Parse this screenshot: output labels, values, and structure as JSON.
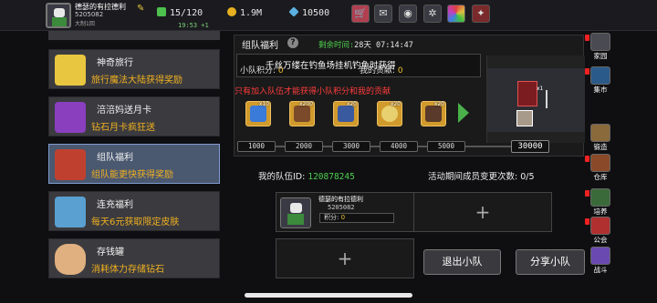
{
  "player": {
    "name": "德瑟的有拉德利",
    "id": "5205082",
    "status": "大制1回",
    "clock": "19:53 +1"
  },
  "resources": {
    "stamina": "15/120",
    "gold": "1.9M",
    "gems": "10500"
  },
  "sidebar": {
    "items": [
      {
        "title": "神奇旅行",
        "subtitle": "旅行魔法大陆获得奖励",
        "icon": "scroll-icon",
        "color": "#e9c640"
      },
      {
        "title": "涪涪妈送月卡",
        "subtitle": "钻石月卡疯狂送",
        "icon": "card-icon",
        "color": "#8a3fbf"
      },
      {
        "title": "组队福利",
        "subtitle": "组队能更快获得奖励",
        "icon": "chest-icon",
        "color": "#c04030"
      },
      {
        "title": "连充福利",
        "subtitle": "每天6元获取限定皮肤",
        "icon": "crystal-icon",
        "color": "#5aa0d0"
      },
      {
        "title": "存钱罐",
        "subtitle": "消耗体力存储钻石",
        "icon": "piggy-bank-icon",
        "color": "#e0b080"
      }
    ]
  },
  "panel": {
    "title": "组队福利",
    "remaining_label": "剩余时间:",
    "remaining_value": "28天 07:14:47",
    "team_points_label": "小队积分:",
    "team_points": "0",
    "contribution_label": "我的贡献:",
    "contribution": "0",
    "warning": "只有加入队伍才能获得小队积分和我的贡献",
    "rewards": [
      {
        "qty": "x10",
        "icon": "lightning-icon",
        "color": "#3a7ad8"
      },
      {
        "qty": "x200",
        "icon": "sword-icon",
        "color": "#7a4a2a"
      },
      {
        "qty": "x20",
        "icon": "rune-icon",
        "color": "#3a5aa0"
      },
      {
        "qty": "x20",
        "icon": "egg-icon",
        "color": "#e8d070"
      },
      {
        "qty": "x20",
        "icon": "scroll-icon",
        "color": "#5a3a2a"
      }
    ],
    "featured_text": "千丝万缕在钓鱼场挂机钓鱼时获得",
    "featured_qty": "x1",
    "milestones": [
      "1000",
      "2000",
      "3000",
      "4000",
      "5000"
    ],
    "milestone_max": "30000"
  },
  "team": {
    "id_label": "我的队伍ID:",
    "id": "120878245",
    "changes_label": "活动期间成员变更次数:",
    "changes": "0/5",
    "member": {
      "name": "德瑟的有拉德利",
      "id": "5205082",
      "points_label": "积分:",
      "points": "0"
    },
    "empty_slot": "+",
    "leave_button": "退出小队",
    "share_button": "分享小队"
  },
  "rightbar": [
    {
      "label": "家园",
      "icon": "home-icon",
      "color": "#4a4a52"
    },
    {
      "label": "集市",
      "icon": "market-icon",
      "color": "#2a5a8a"
    },
    {
      "label": "锻造",
      "icon": "anvil-icon",
      "color": "#8a6a3a"
    },
    {
      "label": "仓库",
      "icon": "warehouse-icon",
      "color": "#8a4a2a"
    },
    {
      "label": "培养",
      "icon": "cultivate-icon",
      "color": "#3a6a3a"
    },
    {
      "label": "公会",
      "icon": "guild-icon",
      "color": "#b03030"
    },
    {
      "label": "战斗",
      "icon": "battle-icon",
      "color": "#6a4ab0"
    }
  ]
}
